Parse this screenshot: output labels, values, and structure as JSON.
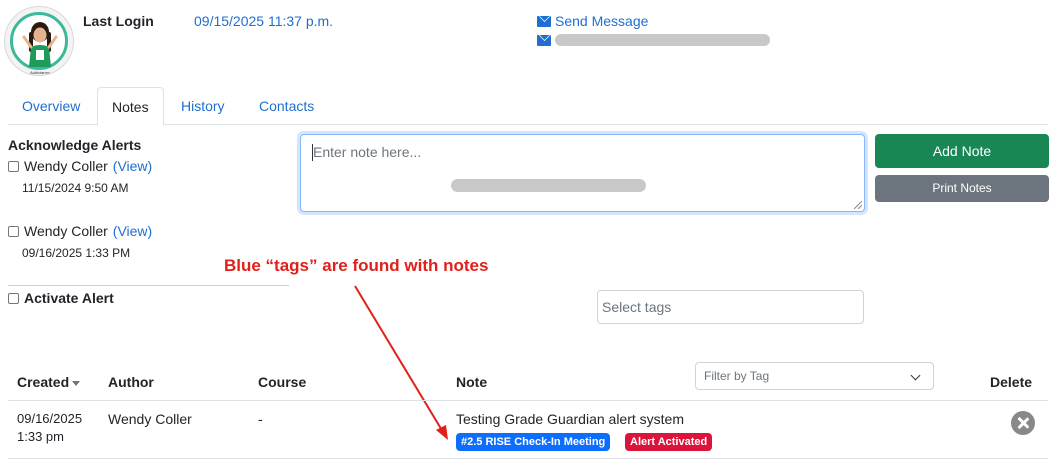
{
  "profile": {
    "avatar_caption": "Addictarmy",
    "last_login_label": "Last Login",
    "last_login_value": "09/15/2025 11:37 p.m.",
    "send_message": "Send Message"
  },
  "tabs": [
    {
      "label": "Overview",
      "active": false
    },
    {
      "label": "Notes",
      "active": true
    },
    {
      "label": "History",
      "active": false
    },
    {
      "label": "Contacts",
      "active": false
    }
  ],
  "acknowledge": {
    "title": "Acknowledge Alerts",
    "items": [
      {
        "name": "Wendy Coller",
        "view": "(View)",
        "date": "11/15/2024 9:50 AM"
      },
      {
        "name": "Wendy Coller",
        "view": "(View)",
        "date": "09/16/2025 1:33 PM"
      }
    ],
    "activate_label": "Activate Alert"
  },
  "note_form": {
    "placeholder": "Enter note here...",
    "add_button": "Add Note",
    "print_button": "Print Notes",
    "tags_placeholder": "Select tags"
  },
  "annotation": {
    "text": "Blue “tags” are found with notes",
    "color": "#e0201a"
  },
  "table": {
    "filter_placeholder": "Filter by Tag",
    "headers": {
      "created": "Created",
      "author": "Author",
      "course": "Course",
      "note": "Note",
      "delete": "Delete"
    },
    "rows": [
      {
        "created_date": "09/16/2025",
        "created_time": "1:33 pm",
        "author": "Wendy Coller",
        "course": "-",
        "note": "Testing Grade Guardian alert system",
        "tags": [
          {
            "label": "#2.5 RISE Check-In Meeting",
            "color": "#0d6efd"
          },
          {
            "label": "Alert Activated",
            "color": "#dc143c"
          }
        ]
      }
    ]
  },
  "colors": {
    "link": "#1f6fd1",
    "add_button": "#198754",
    "print_button": "#6c757d"
  }
}
